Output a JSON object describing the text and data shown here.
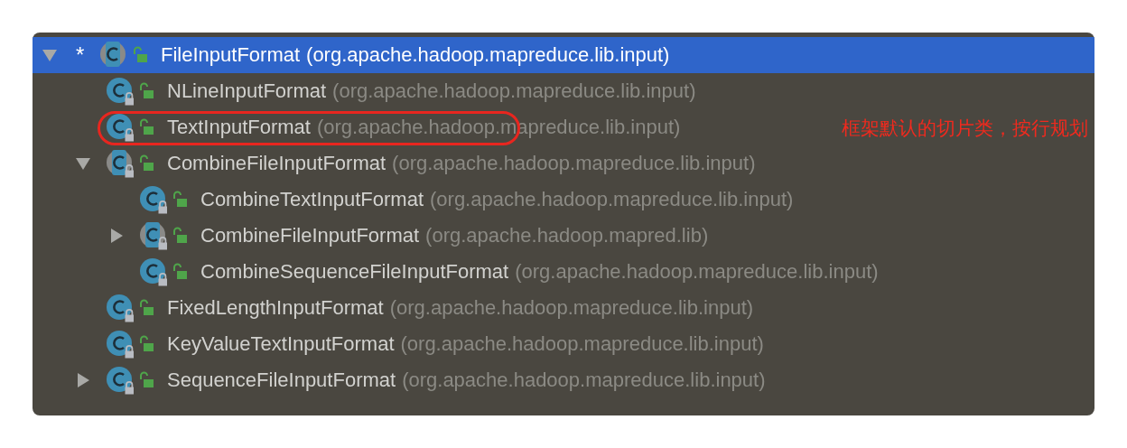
{
  "tree": [
    {
      "name": "FileInputFormat",
      "package": "(org.apache.hadoop.mapreduce.lib.input)",
      "kind": "abstract",
      "locked": false,
      "marker": "*",
      "selected": true,
      "circled": false,
      "expanded": true,
      "children": [
        {
          "name": "NLineInputFormat",
          "package": "(org.apache.hadoop.mapreduce.lib.input)",
          "kind": "class",
          "locked": true,
          "selected": false,
          "circled": false
        },
        {
          "name": "TextInputFormat",
          "package": "(org.apache.hadoop.mapreduce.lib.input)",
          "kind": "class",
          "locked": true,
          "selected": false,
          "circled": true,
          "note": "框架默认的切片类，按行规划"
        },
        {
          "name": "CombineFileInputFormat",
          "package": "(org.apache.hadoop.mapreduce.lib.input)",
          "kind": "abstract",
          "locked": true,
          "selected": false,
          "circled": false,
          "expanded": true,
          "children": [
            {
              "name": "CombineTextInputFormat",
              "package": "(org.apache.hadoop.mapreduce.lib.input)",
              "kind": "class",
              "locked": true,
              "selected": false,
              "circled": false
            },
            {
              "name": "CombineFileInputFormat",
              "package": "(org.apache.hadoop.mapred.lib)",
              "kind": "abstract",
              "locked": true,
              "selected": false,
              "circled": false,
              "expanded": false
            },
            {
              "name": "CombineSequenceFileInputFormat",
              "package": "(org.apache.hadoop.mapreduce.lib.input)",
              "kind": "class",
              "locked": true,
              "selected": false,
              "circled": false
            }
          ]
        },
        {
          "name": "FixedLengthInputFormat",
          "package": "(org.apache.hadoop.mapreduce.lib.input)",
          "kind": "class",
          "locked": true,
          "selected": false,
          "circled": false
        },
        {
          "name": "KeyValueTextInputFormat",
          "package": "(org.apache.hadoop.mapreduce.lib.input)",
          "kind": "class",
          "locked": true,
          "selected": false,
          "circled": false
        },
        {
          "name": "SequenceFileInputFormat",
          "package": "(org.apache.hadoop.mapreduce.lib.input)",
          "kind": "class",
          "locked": true,
          "selected": false,
          "circled": false,
          "expanded": false
        }
      ]
    }
  ]
}
